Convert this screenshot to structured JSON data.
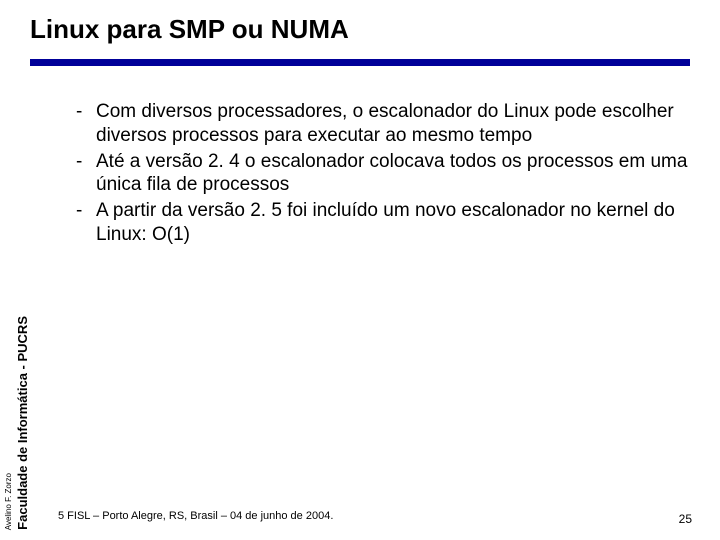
{
  "slide": {
    "title": "Linux para SMP ou NUMA",
    "bullets": [
      "Com diversos processadores, o escalonador do Linux pode escolher diversos processos para executar ao mesmo tempo",
      "Até a versão 2. 4 o escalonador colocava todos os processos em uma única fila de processos",
      "A partir da versão 2. 5 foi incluído um novo escalonador no kernel do Linux: O(1)"
    ],
    "footer": "5 FISL – Porto Alegre, RS, Brasil – 04 de junho de 2004.",
    "page_number": "25"
  },
  "sidebar": {
    "author": "Avelino F. Zorzo",
    "institution": "Faculdade de Informática - PUCRS"
  }
}
